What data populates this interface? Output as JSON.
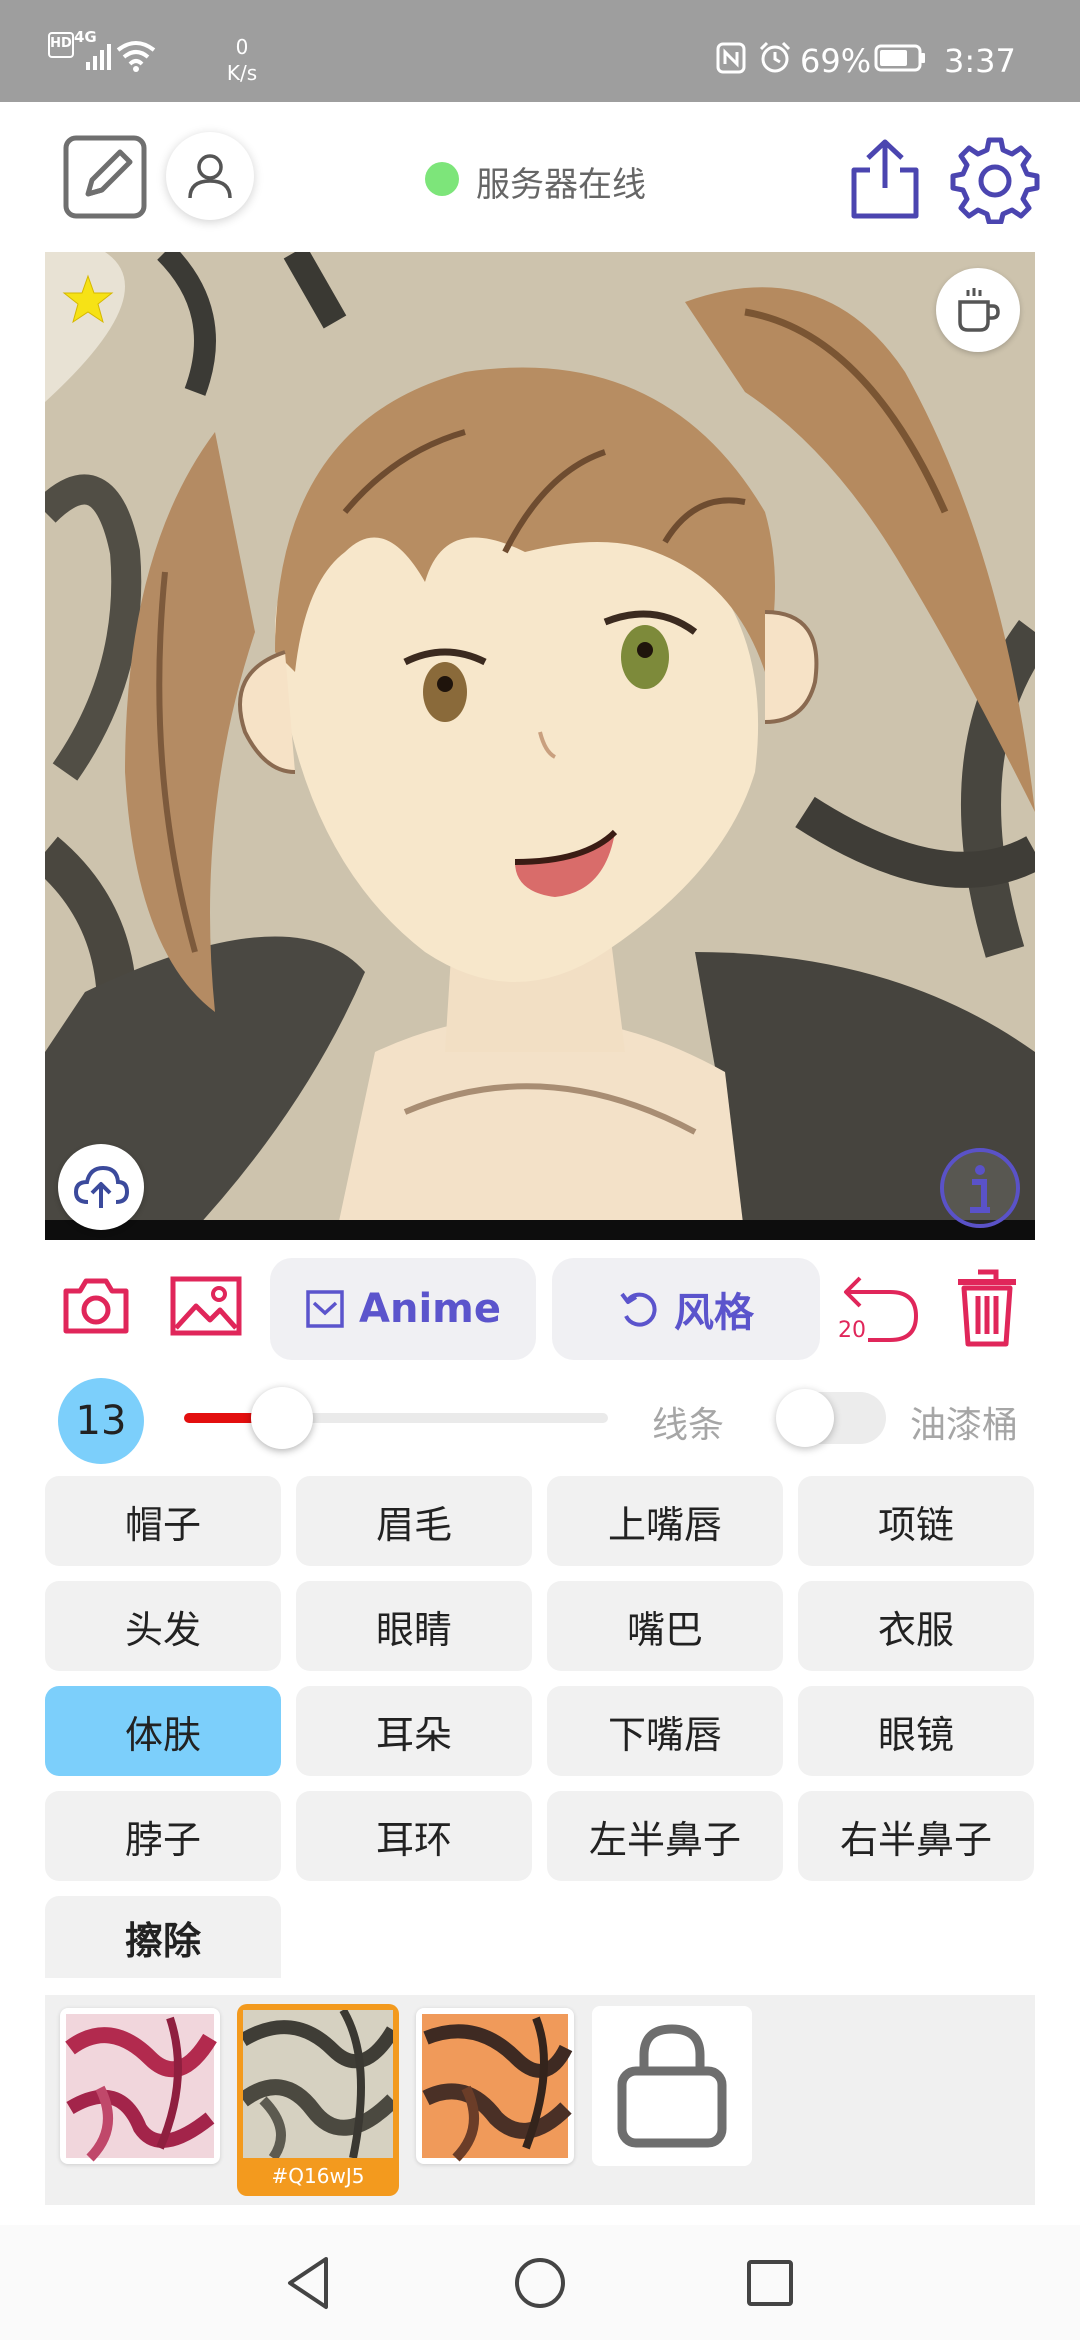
{
  "colors": {
    "accent": "#5b54cc",
    "danger": "#e0265a",
    "selected": "#7ccffb",
    "online": "#7de57a",
    "brush": "#e30f0f",
    "texture_selected": "#f39a1e"
  },
  "status_bar": {
    "hd": "HD",
    "network": "4G",
    "speed_value": "0",
    "speed_unit": "K/s",
    "battery": "69%",
    "time": "3:37"
  },
  "header": {
    "server_status": "服务器在线",
    "icons": [
      "edit-icon",
      "user-icon",
      "share-icon",
      "settings-icon"
    ]
  },
  "canvas": {
    "favorited": true,
    "icons": [
      "star-icon",
      "coffee-icon",
      "cloud-upload-icon",
      "info-icon"
    ]
  },
  "toolbar": {
    "anime_label": "Anime",
    "style_label": "风格",
    "undo_count": "20",
    "icons": [
      "camera-icon",
      "gallery-icon",
      "trash-icon",
      "undo-icon"
    ]
  },
  "brush": {
    "size": "13",
    "level": 0.23,
    "line_label": "线条",
    "bucket_label": "油漆桶",
    "bucket_enabled": false
  },
  "parts": [
    {
      "label": "帽子"
    },
    {
      "label": "眉毛"
    },
    {
      "label": "上嘴唇"
    },
    {
      "label": "项链"
    },
    {
      "label": "头发"
    },
    {
      "label": "眼睛"
    },
    {
      "label": "嘴巴"
    },
    {
      "label": "衣服"
    },
    {
      "label": "体肤",
      "selected": true
    },
    {
      "label": "耳朵"
    },
    {
      "label": "下嘴唇"
    },
    {
      "label": "眼镜"
    },
    {
      "label": "脖子"
    },
    {
      "label": "耳环"
    },
    {
      "label": "左半鼻子"
    },
    {
      "label": "右半鼻子"
    },
    {
      "label": "擦除",
      "bold": true
    }
  ],
  "textures": {
    "selected_code": "#Q16wJ5",
    "icons": [
      "lock-icon"
    ]
  }
}
